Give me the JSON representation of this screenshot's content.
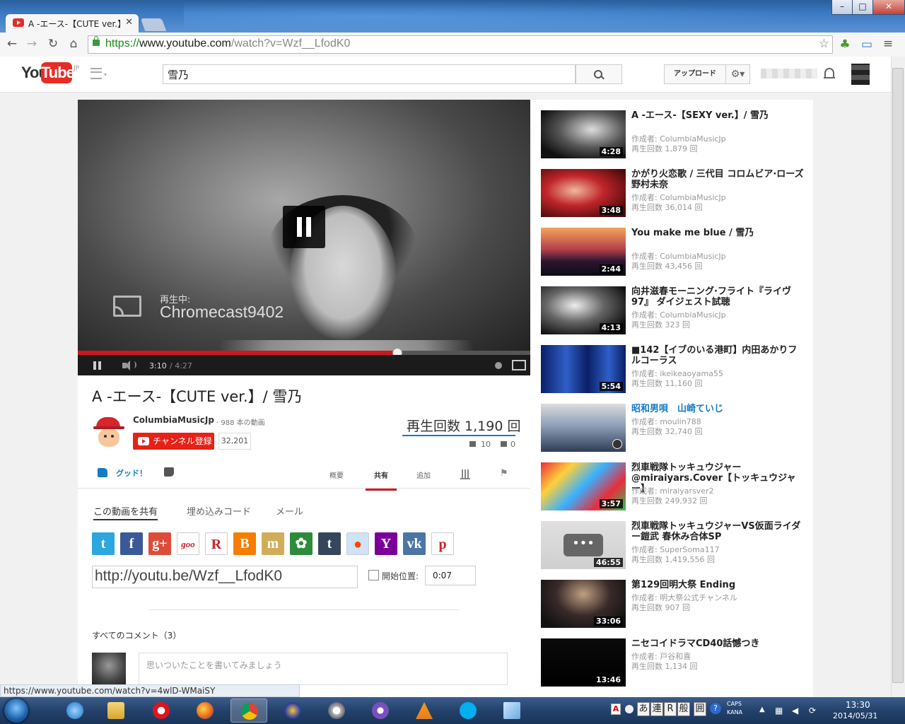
{
  "browser": {
    "tab_title": "A -エース-【CUTE ver.】",
    "url_scheme": "https://",
    "url_host": "www.youtube.com",
    "url_path": "/watch?v=Wzf__LfodK0",
    "status_url": "https://www.youtube.com/watch?v=4wlD-WMaiSY"
  },
  "header": {
    "logo_you": "You",
    "logo_tube": "Tube",
    "logo_region": "JP",
    "search_value": "雪乃",
    "upload_label": "アップロード"
  },
  "player": {
    "cast_status_label": "再生中:",
    "cast_device": "Chromecast9402",
    "current_time": "3:10",
    "duration": "/ 4:27",
    "progress_fraction": 0.706
  },
  "video": {
    "title": "A -エース-【CUTE ver.】/ 雪乃",
    "channel": "ColumbiaMusicJp",
    "channel_videos": "· 988 本の動画",
    "subscribe_label": "チャンネル登録",
    "subscriber_count": "32,201",
    "views": "再生回数 1,190 回",
    "likes": "10",
    "dislikes": "0",
    "like_label": "グッド！"
  },
  "tabs": [
    {
      "label": "概要"
    },
    {
      "label": "共有"
    },
    {
      "label": "追加"
    }
  ],
  "share": {
    "subtabs": [
      "この動画を共有",
      "埋め込みコード",
      "メール"
    ],
    "services": [
      {
        "name": "twitter",
        "glyph": "t",
        "color": "#2ca7e0"
      },
      {
        "name": "facebook",
        "glyph": "f",
        "color": "#3b5998"
      },
      {
        "name": "googleplus",
        "glyph": "g+",
        "color": "#dd4b39"
      },
      {
        "name": "goo",
        "glyph": "goo",
        "color": "#ffffff"
      },
      {
        "name": "rakuten",
        "glyph": "R",
        "color": "#ffffff"
      },
      {
        "name": "blogger",
        "glyph": "B",
        "color": "#f57d00"
      },
      {
        "name": "mixi",
        "glyph": "m",
        "color": "#d1ad59"
      },
      {
        "name": "ameba",
        "glyph": "✿",
        "color": "#2d8c3c"
      },
      {
        "name": "tumblr",
        "glyph": "t",
        "color": "#35465c"
      },
      {
        "name": "reddit",
        "glyph": "●",
        "color": "#cee3f8"
      },
      {
        "name": "yahoo",
        "glyph": "Y",
        "color": "#7b0099"
      },
      {
        "name": "vk",
        "glyph": "vk",
        "color": "#4c75a3"
      },
      {
        "name": "pinterest",
        "glyph": "p",
        "color": "#ffffff"
      }
    ],
    "short_url": "http://youtu.be/Wzf__LfodK0",
    "start_label": "開始位置:",
    "start_value": "0:07"
  },
  "comments": {
    "header": "すべてのコメント（3）",
    "placeholder": "思いついたことを書いてみましょう"
  },
  "related": [
    {
      "title": "A -エース-【SEXY ver.】/ 雪乃",
      "by": "作成者: ColumbiaMusicJp",
      "views": "再生回数 1,879 回",
      "duration": "4:28"
    },
    {
      "title": "かがり火恋歌 / 三代目 コロムビア·ローズ 野村未奈",
      "by": "作成者: ColumbiaMusicJp",
      "views": "再生回数 36,014 回",
      "duration": "3:48"
    },
    {
      "title": "You make me blue / 雪乃",
      "by": "作成者: ColumbiaMusicJp",
      "views": "再生回数 43,456 回",
      "duration": "2:44"
    },
    {
      "title": "向井滋春モーニング·フライト『ライヴ97』 ダイジェスト試聴",
      "by": "作成者: ColumbiaMusicJp",
      "views": "再生回数 323 回",
      "duration": "4:13"
    },
    {
      "title": "■142【イブのいる港町】内田あかりフルコーラス",
      "by": "作成者: ikeikeaoyama55",
      "views": "再生回数 11,160 回",
      "duration": "5:54"
    },
    {
      "title": "昭和男唄　山崎ていじ",
      "by": "作成者: moulin788",
      "views": "再生回数 32,740 回",
      "duration": ""
    },
    {
      "title": "烈車戦隊トッキュウジャー @miraiyars.Cover【トッキュウジャー】",
      "by": "作成者: miraiyarsver2",
      "views": "再生回数 249,932 回",
      "duration": "3:57"
    },
    {
      "title": "烈車戦隊トッキュウジャーVS仮面ライダー鎧武 春休み合体SP",
      "by": "作成者: SuperSoma117",
      "views": "再生回数 1,419,556 回",
      "duration": "46:55"
    },
    {
      "title": "第129回明大祭 Ending",
      "by": "作成者: 明大祭公式チャンネル",
      "views": "再生回数 907 回",
      "duration": "33:06"
    },
    {
      "title": "ニセコイドラマCD40話憾つき",
      "by": "作成者: 戸谷和喜",
      "views": "再生回数 1,134 回",
      "duration": "13:46"
    }
  ],
  "taskbar": {
    "time": "13:30",
    "date": "2014/05/31",
    "ime": [
      "あ",
      "連",
      "R",
      "般",
      "囲"
    ],
    "caps": "CAPS",
    "kana": "KANA"
  }
}
